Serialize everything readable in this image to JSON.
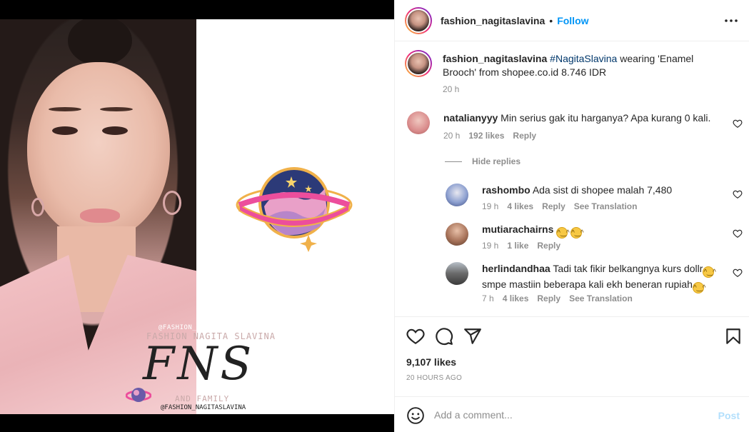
{
  "media": {
    "watermark_handle": "@FASHION_NAGITASLAVINA",
    "watermark_title": "FASHION NAGITA SLAVINA",
    "watermark_logo": "FNS",
    "watermark_family": "AND FAMILY",
    "watermark_handle_bottom": "@FASHION_NAGITASLAVINA"
  },
  "header": {
    "username": "fashion_nagitaslavina",
    "separator": "•",
    "follow_label": "Follow",
    "more_icon": "more-options-icon"
  },
  "caption": {
    "username": "fashion_nagitaslavina",
    "hashtag": "#NagitaSlavina",
    "text": " wearing 'Enamel Brooch' from shopee.co.id 8.746 IDR",
    "time": "20 h"
  },
  "comments": [
    {
      "username": "natalianyyy",
      "text": "Min serius gak itu harganya? Apa kurang 0 kali.",
      "time": "20 h",
      "likes": "192 likes",
      "reply": "Reply",
      "avatar_color": "#d98b8b"
    }
  ],
  "hide_replies": "Hide replies",
  "replies": [
    {
      "username": "rashombo",
      "text": "Ada sist di shopee malah 7,480",
      "time": "19 h",
      "likes": "4 likes",
      "reply": "Reply",
      "translate": "See Translation",
      "avatar_color": "#6d7fb8"
    },
    {
      "username": "mutiarachairns",
      "text": "",
      "emoji": [
        "😂",
        "😂"
      ],
      "time": "19 h",
      "likes": "1 like",
      "reply": "Reply",
      "avatar_color": "#a8735a"
    },
    {
      "username": "herlindandhaa",
      "text": "Tadi tak fikir belkangnya kurs dollr",
      "text2": "smpe mastiin beberapa kali ekh beneran rupiah",
      "emoji1": "😂",
      "emoji2": "🤣",
      "time": "7 h",
      "likes": "4 likes",
      "reply": "Reply",
      "translate": "See Translation",
      "avatar_color": "#6a6a6a"
    }
  ],
  "actions": {
    "like_icon": "heart-icon",
    "comment_icon": "comment-icon",
    "share_icon": "share-icon",
    "save_icon": "bookmark-icon"
  },
  "likes_count": "9,107 likes",
  "posted_ago": "20 HOURS AGO",
  "add_comment": {
    "placeholder": "Add a comment...",
    "post_label": "Post",
    "emoji_icon": "emoji-icon"
  },
  "colors": {
    "link_blue": "#0095f6",
    "post_disabled": "#b2dffc",
    "hashtag": "#00376b",
    "muted": "#8e8e8e"
  }
}
